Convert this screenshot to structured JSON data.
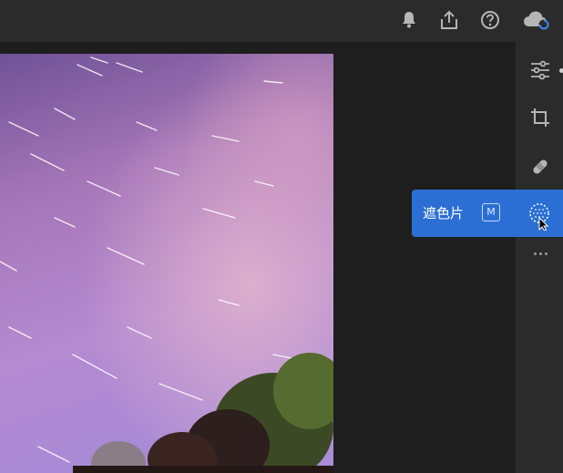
{
  "colors": {
    "topbar_bg": "#2b2b2b",
    "workspace_bg": "#1e1e1e",
    "accent": "#2b6fd4",
    "icon": "#b5b5b5",
    "sync_spinner": "#3d8af7"
  },
  "topbar": {
    "icons": [
      "bell-icon",
      "share-icon",
      "help-icon",
      "cloud-sync-icon"
    ]
  },
  "right_panel": {
    "tools": [
      "edit-sliders-icon",
      "crop-icon",
      "healing-icon",
      "masking-icon",
      "more-icon"
    ]
  },
  "tooltip": {
    "label": "遮色片",
    "shortcut": "M"
  }
}
